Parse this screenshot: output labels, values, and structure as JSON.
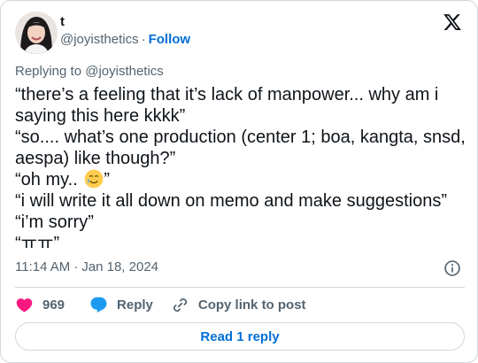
{
  "author": {
    "display_name": "t",
    "handle": "@joyisthetics",
    "separator": "·",
    "follow_label": "Follow"
  },
  "reply_context": "Replying to @joyisthetics",
  "tweet": {
    "lines": [
      "“there’s a feeling that it’s lack of manpower... why am i saying this here kkkk”",
      "“so.... what’s one production (center 1; boa, kangta, snsd, aespa) like though?”",
      "“oh my..",
      "”",
      "“i will write it all down on memo and make suggestions”",
      "“i’m sorry”",
      "“ㅠㅠ”"
    ]
  },
  "timestamp": {
    "time": "11:14 AM",
    "separator": "·",
    "date": "Jan 18, 2024"
  },
  "actions": {
    "like_count": "969",
    "reply_label": "Reply",
    "copy_link_label": "Copy link to post"
  },
  "read_reply_label": "Read 1 reply",
  "colors": {
    "accent": "#006fd6",
    "like": "#f91880",
    "reply_icon": "#1d9bf0",
    "muted": "#536471",
    "border": "#cfd9de"
  },
  "icons": [
    "x-logo-icon",
    "info-icon",
    "heart-icon",
    "reply-bubble-icon",
    "link-icon",
    "tear-smile-emoji"
  ]
}
